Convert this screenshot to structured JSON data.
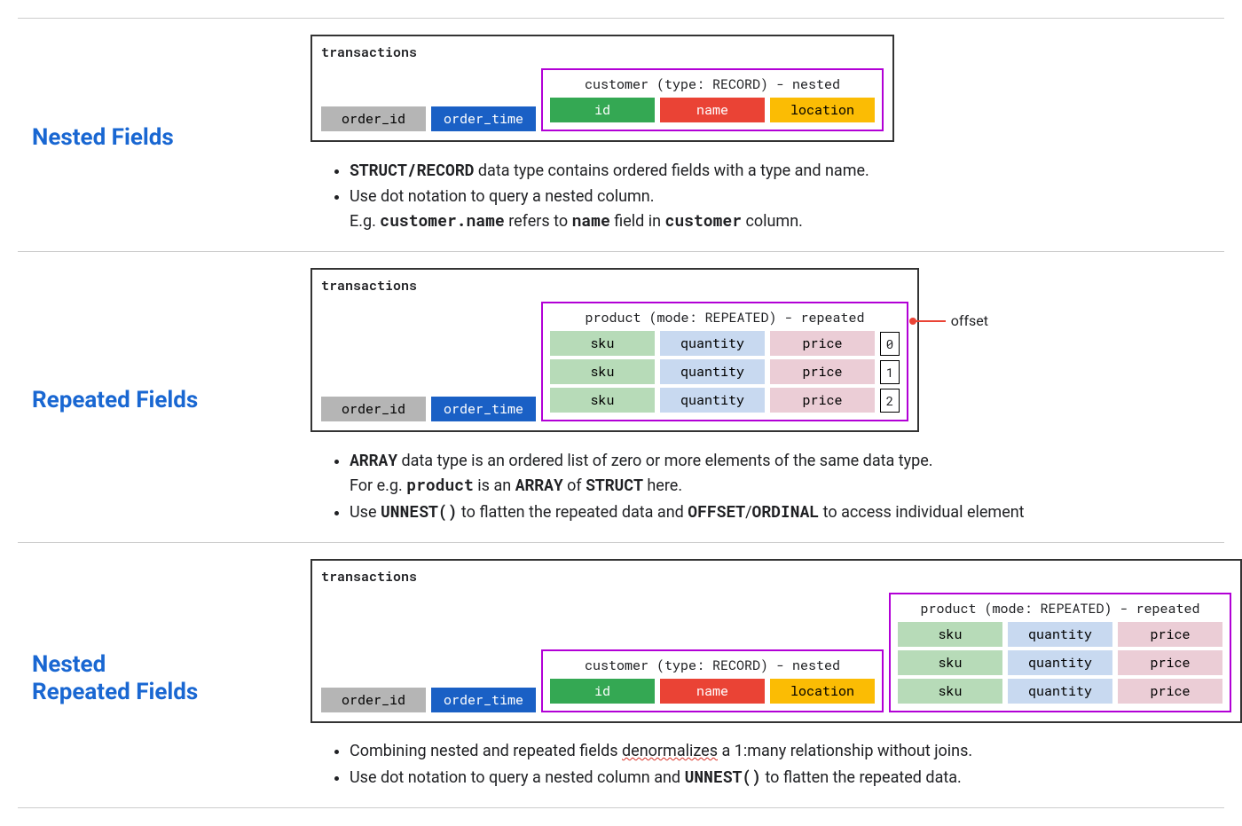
{
  "sections": [
    {
      "title": "Nested Fields",
      "tx_label": "transactions",
      "cols": [
        "order_id",
        "order_time"
      ],
      "nested": {
        "caption": "customer (type: RECORD) - nested",
        "fields": [
          "id",
          "name",
          "location"
        ]
      },
      "bullets": [
        {
          "frags": [
            {
              "t": "STRUCT/RECORD",
              "cls": "mono"
            },
            {
              "t": " data type contains ordered fields with a type and name."
            }
          ]
        },
        {
          "frags": [
            {
              "t": "Use dot notation to query a nested column."
            }
          ],
          "sub": [
            {
              "t": "E.g. "
            },
            {
              "t": "customer.name",
              "cls": "mono"
            },
            {
              "t": " refers to "
            },
            {
              "t": "name",
              "cls": "mono"
            },
            {
              "t": " field in "
            },
            {
              "t": "customer",
              "cls": "mono"
            },
            {
              "t": " column."
            }
          ]
        }
      ]
    },
    {
      "title": "Repeated Fields",
      "tx_label": "transactions",
      "cols": [
        "order_id",
        "order_time"
      ],
      "repeated": {
        "caption": "product (mode: REPEATED) - repeated",
        "fields": [
          "sku",
          "quantity",
          "price"
        ],
        "offsets": [
          "0",
          "1",
          "2"
        ],
        "callout": "offset"
      },
      "bullets": [
        {
          "frags": [
            {
              "t": "ARRAY",
              "cls": "mono"
            },
            {
              "t": " data type is an ordered list of zero or more elements of the same data type."
            }
          ],
          "sub": [
            {
              "t": "For e.g. "
            },
            {
              "t": "product",
              "cls": "mono"
            },
            {
              "t": " is an "
            },
            {
              "t": "ARRAY",
              "cls": "mono"
            },
            {
              "t": " of "
            },
            {
              "t": "STRUCT",
              "cls": "mono"
            },
            {
              "t": " here."
            }
          ]
        },
        {
          "frags": [
            {
              "t": "Use "
            },
            {
              "t": "UNNEST()",
              "cls": "mono"
            },
            {
              "t": " to flatten the repeated data and "
            },
            {
              "t": "OFFSET",
              "cls": "mono"
            },
            {
              "t": "/"
            },
            {
              "t": "ORDINAL",
              "cls": "mono"
            },
            {
              "t": " to access individual element"
            }
          ]
        }
      ]
    },
    {
      "title": "Nested\nRepeated Fields",
      "tx_label": "transactions",
      "cols": [
        "order_id",
        "order_time"
      ],
      "nested": {
        "caption": "customer (type: RECORD) - nested",
        "fields": [
          "id",
          "name",
          "location"
        ]
      },
      "repeated": {
        "caption": "product (mode: REPEATED) - repeated",
        "fields": [
          "sku",
          "quantity",
          "price"
        ],
        "rows": 3
      },
      "bullets": [
        {
          "frags": [
            {
              "t": "Combining nested and repeated fields "
            },
            {
              "t": "denormalizes",
              "cls": "squiggle"
            },
            {
              "t": " a 1:many relationship without joins."
            }
          ]
        },
        {
          "frags": [
            {
              "t": "Use dot notation to query a nested column and "
            },
            {
              "t": "UNNEST()",
              "cls": "mono"
            },
            {
              "t": " to flatten the repeated data."
            }
          ]
        }
      ]
    }
  ]
}
